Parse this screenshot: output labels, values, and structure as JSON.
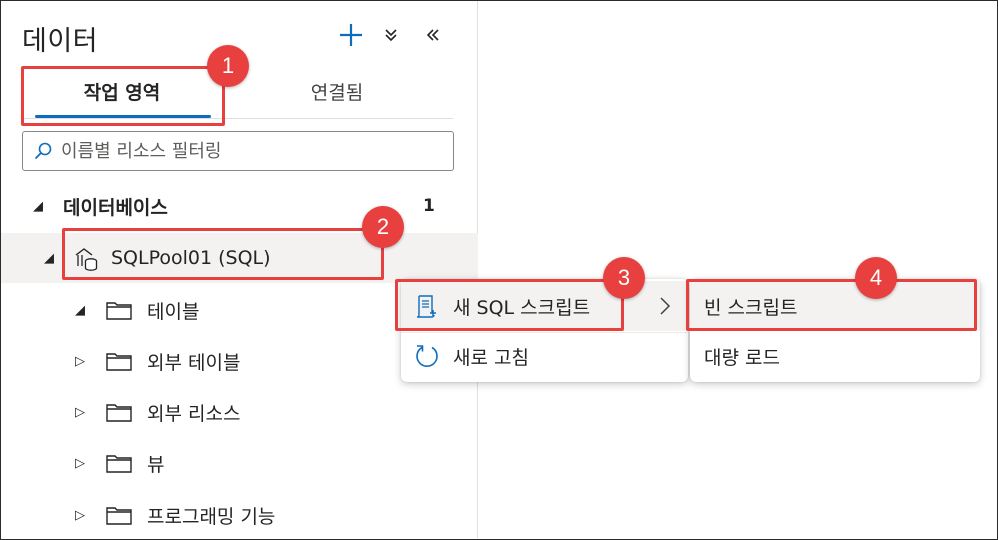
{
  "panel": {
    "title": "데이터",
    "icons": {
      "add": "plus-icon",
      "expand_all": "double-chevron-down-icon",
      "collapse_panel": "double-chevron-left-icon"
    }
  },
  "tabs": [
    {
      "label": "작업 영역",
      "selected": true
    },
    {
      "label": "연결됨",
      "selected": false
    }
  ],
  "search": {
    "placeholder": "이름별 리소스 필터링",
    "value": "",
    "icon": "search-icon"
  },
  "tree": {
    "databases": {
      "label": "데이터베이스",
      "count": "1",
      "expanded": true
    },
    "pool": {
      "label": "SQLPool01 (SQL)",
      "icon": "sql-pool-icon",
      "expanded": true
    },
    "folders": [
      {
        "label": "테이블",
        "expanded": true
      },
      {
        "label": "외부 테이블",
        "expanded": false
      },
      {
        "label": "외부 리소스",
        "expanded": false
      },
      {
        "label": "뷰",
        "expanded": false
      },
      {
        "label": "프로그래밍 기능",
        "expanded": false
      }
    ]
  },
  "context_menu": {
    "items": [
      {
        "label": "새 SQL 스크립트",
        "icon": "script-icon",
        "has_submenu": true
      },
      {
        "label": "새로 고침",
        "icon": "refresh-icon"
      }
    ]
  },
  "submenu": {
    "items": [
      {
        "label": "빈 스크립트"
      },
      {
        "label": "대량 로드"
      }
    ]
  },
  "callouts": [
    "1",
    "2",
    "3",
    "4"
  ],
  "colors": {
    "accent": "#0f6cbd",
    "callout": "#e8403f",
    "hover": "#f3f2f1"
  }
}
